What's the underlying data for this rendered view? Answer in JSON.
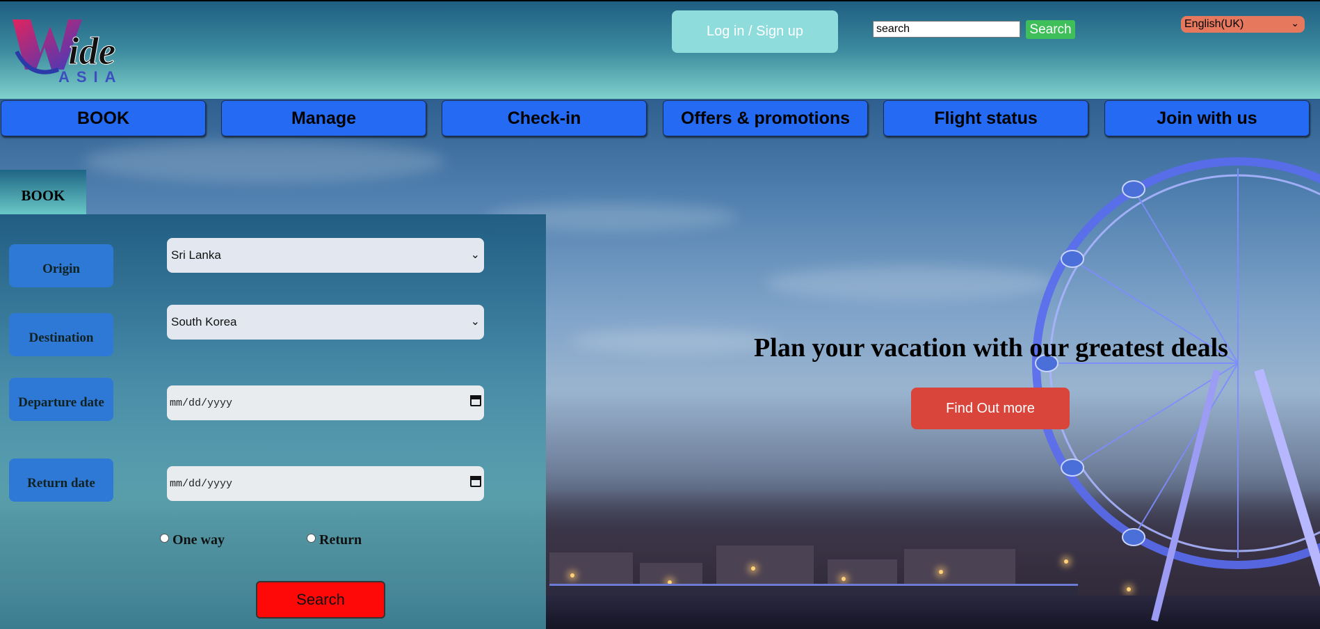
{
  "header": {
    "logo_text_main": "Wide",
    "logo_text_sub": "ASIA",
    "login_label": "Log in / Sign up",
    "search_placeholder": "search",
    "search_value": "search",
    "search_button": "Search",
    "language": "English(UK)"
  },
  "nav": {
    "items": [
      {
        "label": "BOOK"
      },
      {
        "label": "Manage"
      },
      {
        "label": "Check-in"
      },
      {
        "label": "Offers & promotions"
      },
      {
        "label": "Flight status"
      },
      {
        "label": "Join with us"
      }
    ]
  },
  "booking": {
    "tab_label": "BOOK",
    "origin_label": "Origin",
    "origin_value": "Sri Lanka",
    "destination_label": "Destination",
    "destination_value": "South Korea",
    "departure_label": "Departure date",
    "departure_placeholder": "mm/dd/yyyy",
    "return_label": "Return date",
    "return_placeholder": "mm/dd/yyyy",
    "one_way_label": "One way",
    "return_trip_label": "Return",
    "search_button": "Search"
  },
  "hero": {
    "title": "Plan your vacation with our greatest deals",
    "cta": "Find Out more"
  },
  "colors": {
    "nav_blue": "#246af2",
    "login_teal": "#8fdcdc",
    "search_green": "#3fbf5a",
    "language_orange": "#e5785d",
    "cta_red": "#d9453b",
    "book_search_red": "#ff0808"
  }
}
